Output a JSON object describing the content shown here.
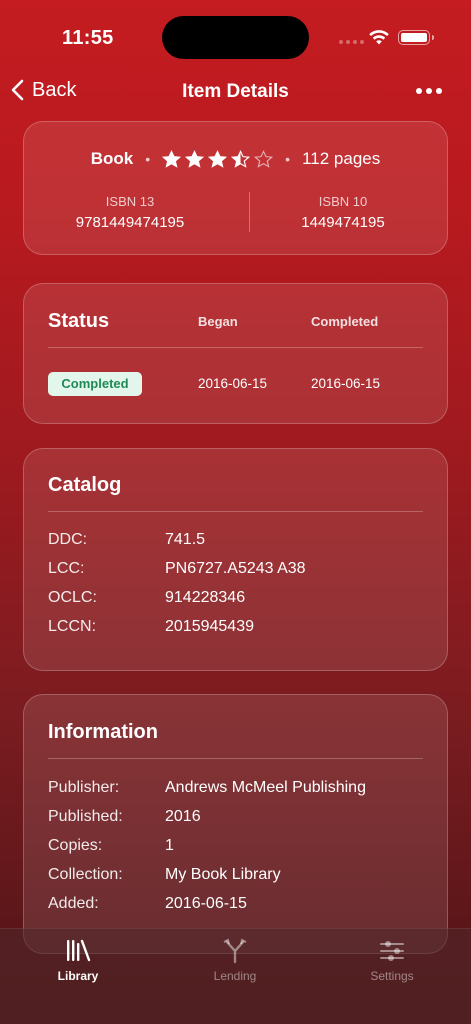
{
  "status_bar": {
    "time": "11:55"
  },
  "nav": {
    "back_label": "Back",
    "title": "Item Details"
  },
  "summary": {
    "type": "Book",
    "rating": 3.5,
    "rating_max": 5,
    "pages": "112 pages",
    "isbn13_label": "ISBN 13",
    "isbn13": "9781449474195",
    "isbn10_label": "ISBN 10",
    "isbn10": "1449474195"
  },
  "status": {
    "title": "Status",
    "began_label": "Began",
    "completed_label": "Completed",
    "badge": "Completed",
    "began": "2016-06-15",
    "completed": "2016-06-15",
    "badge_bg": "#e2f6ec",
    "badge_color": "#1f8a55"
  },
  "catalog": {
    "title": "Catalog",
    "rows": [
      {
        "key": "DDC:",
        "value": "741.5"
      },
      {
        "key": "LCC:",
        "value": "PN6727.A5243 A38"
      },
      {
        "key": "OCLC:",
        "value": "914228346"
      },
      {
        "key": "LCCN:",
        "value": "2015945439"
      }
    ]
  },
  "information": {
    "title": "Information",
    "rows": [
      {
        "key": "Publisher:",
        "value": "Andrews McMeel Publishing"
      },
      {
        "key": "Published:",
        "value": "2016"
      },
      {
        "key": "Copies:",
        "value": "1"
      },
      {
        "key": "Collection:",
        "value": "My Book Library"
      },
      {
        "key": "Added:",
        "value": "2016-06-15"
      }
    ]
  },
  "tabs": [
    {
      "label": "Library",
      "icon": "library-icon",
      "active": true
    },
    {
      "label": "Lending",
      "icon": "lending-icon",
      "active": false
    },
    {
      "label": "Settings",
      "icon": "settings-icon",
      "active": false
    }
  ],
  "colors": {
    "accent": "#c41c20"
  }
}
